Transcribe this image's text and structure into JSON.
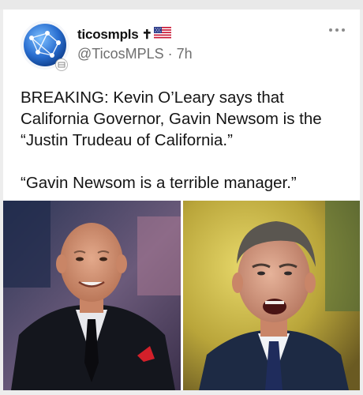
{
  "post": {
    "username": "ticosmpls",
    "name_emoji_cross": "✝",
    "flag_icon": "us-flag-icon",
    "handle": "@TicosMPLS",
    "separator": "·",
    "time": "7h",
    "more_icon": "more-options-icon",
    "text_line1": "BREAKING: Kevin O’Leary says that California Governor, Gavin Newsom is the “Justin Trudeau of California.”",
    "text_line2": "“Gavin Newsom is a terrible manager.”"
  },
  "colors": {
    "card_background": "#ffffff",
    "page_background": "#ededed",
    "handle_gray": "#6f6f6f",
    "avatar_blue": "#2a6fd1"
  }
}
